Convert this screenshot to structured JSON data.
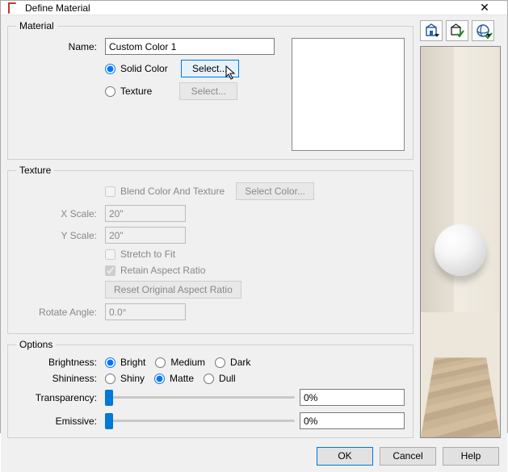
{
  "window": {
    "title": "Define Material"
  },
  "material": {
    "legend": "Material",
    "name_label": "Name:",
    "name_value": "Custom Color 1",
    "solid_color_label": "Solid Color",
    "texture_label": "Texture",
    "select_label": "Select...",
    "mode": "solid"
  },
  "texture": {
    "legend": "Texture",
    "blend_label": "Blend Color And Texture",
    "select_color_label": "Select Color...",
    "xscale_label": "X Scale:",
    "xscale_value": "20\"",
    "yscale_label": "Y Scale:",
    "yscale_value": "20\"",
    "stretch_label": "Stretch to Fit",
    "retain_label": "Retain Aspect Ratio",
    "reset_label": "Reset Original Aspect Ratio",
    "rotate_label": "Rotate Angle:",
    "rotate_value": "0.0°"
  },
  "options": {
    "legend": "Options",
    "brightness_label": "Brightness:",
    "brightness_values": [
      "Bright",
      "Medium",
      "Dark"
    ],
    "brightness_selected": 0,
    "shininess_label": "Shininess:",
    "shininess_values": [
      "Shiny",
      "Matte",
      "Dull"
    ],
    "shininess_selected": 1,
    "transparency_label": "Transparency:",
    "transparency_value": "0%",
    "emissive_label": "Emissive:",
    "emissive_value": "0%"
  },
  "footer": {
    "ok": "OK",
    "cancel": "Cancel",
    "help": "Help"
  }
}
